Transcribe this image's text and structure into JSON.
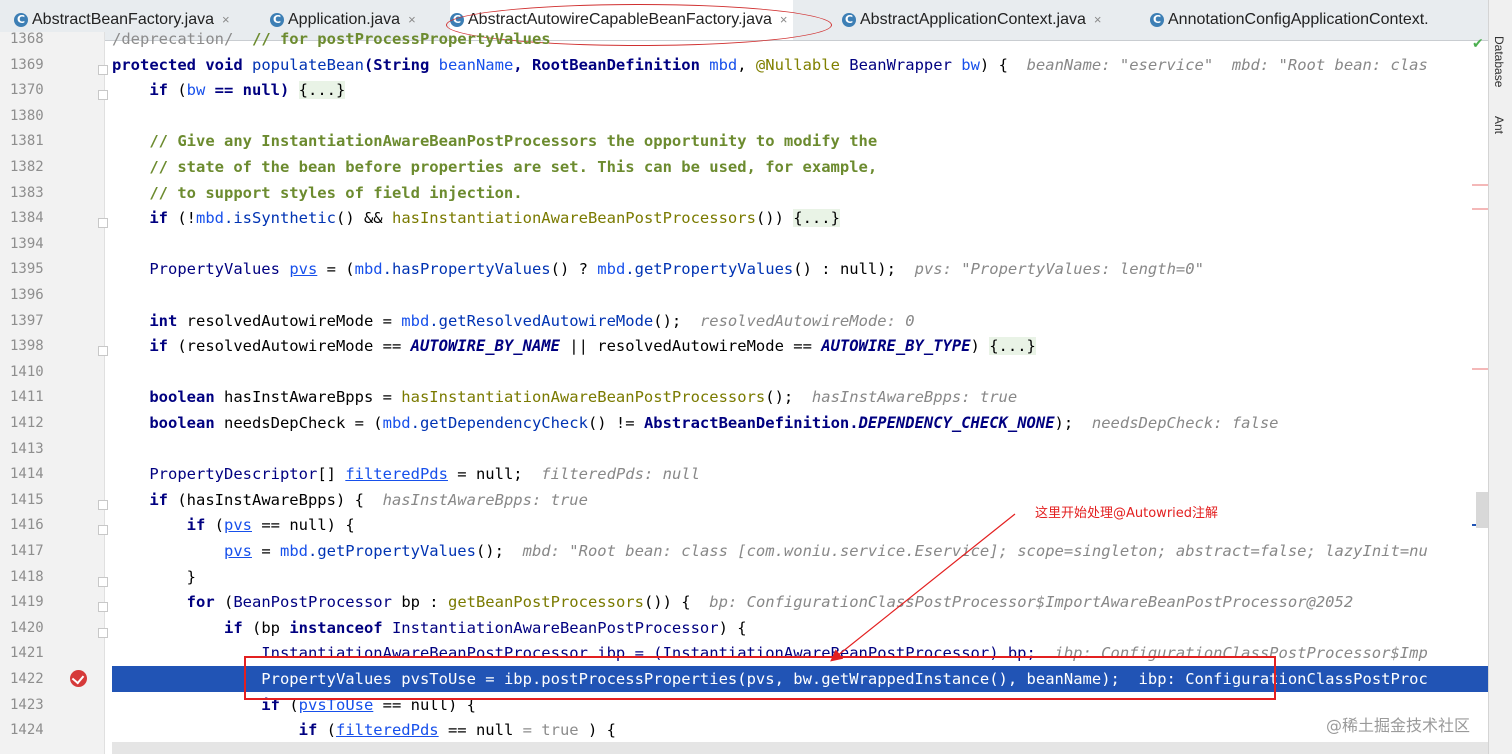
{
  "tabs": [
    {
      "label": "AbstractBeanFactory.java",
      "close": "×"
    },
    {
      "label": "Application.java",
      "close": "×"
    },
    {
      "label": "AbstractAutowireCapableBeanFactory.java",
      "close": "×"
    },
    {
      "label": "AbstractApplicationContext.java",
      "close": "×"
    },
    {
      "label": "AnnotationConfigApplicationContext.",
      "close": ""
    }
  ],
  "tab_icon_letter": "C",
  "side_tools": [
    "Database",
    "Ant"
  ],
  "annotation_text": "这里开始处理@Autowried注解",
  "watermark": "@稀土掘金技术社区",
  "editor": {
    "breakpoint_line": "1422",
    "lines": [
      {
        "n": "1368",
        "segments": [
          {
            "t": "/deprecation/  ",
            "c": "cs"
          },
          {
            "t": "// for postProcessPropertyValues",
            "c": "c"
          }
        ]
      },
      {
        "n": "1369",
        "segments": [
          {
            "t": "protected void ",
            "c": "k"
          },
          {
            "t": "populateBean",
            "c": "m"
          },
          {
            "t": "(String ",
            "c": "k"
          },
          {
            "t": "beanName",
            "c": "v"
          },
          {
            "t": ", RootBeanDefinition ",
            "c": "k"
          },
          {
            "t": "mbd",
            "c": "v"
          },
          {
            "t": ", ",
            "c": ""
          },
          {
            "t": "@Nullable ",
            "c": "an"
          },
          {
            "t": "BeanWrapper ",
            "c": "t"
          },
          {
            "t": "bw",
            "c": "v"
          },
          {
            "t": ") {  ",
            "c": ""
          },
          {
            "t": "beanName: \"eservice\"  mbd: \"Root bean: clas",
            "c": "h"
          }
        ]
      },
      {
        "n": "1370",
        "segments": [
          {
            "t": "    if ",
            "c": "k"
          },
          {
            "t": "(",
            "c": ""
          },
          {
            "t": "bw",
            "c": "v"
          },
          {
            "t": " == null) ",
            "c": "k"
          },
          {
            "t": "{...}",
            "c": "fb"
          }
        ]
      },
      {
        "n": "1380",
        "segments": []
      },
      {
        "n": "1381",
        "segments": [
          {
            "t": "    // Give any InstantiationAwareBeanPostProcessors the opportunity to modify the",
            "c": "c"
          }
        ]
      },
      {
        "n": "1382",
        "segments": [
          {
            "t": "    // state of the bean before properties are set. This can be used, for example,",
            "c": "c"
          }
        ]
      },
      {
        "n": "1383",
        "segments": [
          {
            "t": "    // to support styles of field injection.",
            "c": "c"
          }
        ]
      },
      {
        "n": "1384",
        "segments": [
          {
            "t": "    if ",
            "c": "k"
          },
          {
            "t": "(!",
            "c": ""
          },
          {
            "t": "mbd",
            "c": "v"
          },
          {
            "t": ".isSynthetic",
            "c": "m"
          },
          {
            "t": "() && ",
            "c": ""
          },
          {
            "t": "hasInstantiationAwareBeanPostProcessors",
            "c": "f"
          },
          {
            "t": "()) ",
            "c": ""
          },
          {
            "t": "{...}",
            "c": "fb"
          }
        ]
      },
      {
        "n": "1394",
        "segments": []
      },
      {
        "n": "1395",
        "segments": [
          {
            "t": "    PropertyValues ",
            "c": "t"
          },
          {
            "t": "pvs",
            "c": "u"
          },
          {
            "t": " = (",
            "c": ""
          },
          {
            "t": "mbd",
            "c": "v"
          },
          {
            "t": ".hasPropertyValues",
            "c": "m"
          },
          {
            "t": "() ? ",
            "c": ""
          },
          {
            "t": "mbd",
            "c": "v"
          },
          {
            "t": ".getPropertyValues",
            "c": "m"
          },
          {
            "t": "() : null);  ",
            "c": ""
          },
          {
            "t": "pvs: \"PropertyValues: length=0\"",
            "c": "h"
          }
        ]
      },
      {
        "n": "1396",
        "segments": []
      },
      {
        "n": "1397",
        "segments": [
          {
            "t": "    int ",
            "c": "k"
          },
          {
            "t": "resolvedAutowireMode = ",
            "c": ""
          },
          {
            "t": "mbd",
            "c": "v"
          },
          {
            "t": ".getResolvedAutowireMode",
            "c": "m"
          },
          {
            "t": "();  ",
            "c": ""
          },
          {
            "t": "resolvedAutowireMode: 0",
            "c": "h"
          }
        ]
      },
      {
        "n": "1398",
        "segments": [
          {
            "t": "    if ",
            "c": "k"
          },
          {
            "t": "(resolvedAutowireMode == ",
            "c": ""
          },
          {
            "t": "AUTOWIRE_BY_NAME",
            "c": "it"
          },
          {
            "t": " || resolvedAutowireMode == ",
            "c": ""
          },
          {
            "t": "AUTOWIRE_BY_TYPE",
            "c": "it"
          },
          {
            "t": ") ",
            "c": ""
          },
          {
            "t": "{...}",
            "c": "fb"
          }
        ]
      },
      {
        "n": "1410",
        "segments": []
      },
      {
        "n": "1411",
        "segments": [
          {
            "t": "    boolean ",
            "c": "k"
          },
          {
            "t": "hasInstAwareBpps = ",
            "c": ""
          },
          {
            "t": "hasInstantiationAwareBeanPostProcessors",
            "c": "f"
          },
          {
            "t": "();  ",
            "c": ""
          },
          {
            "t": "hasInstAwareBpps: true",
            "c": "h"
          }
        ]
      },
      {
        "n": "1412",
        "segments": [
          {
            "t": "    boolean ",
            "c": "k"
          },
          {
            "t": "needsDepCheck = (",
            "c": ""
          },
          {
            "t": "mbd",
            "c": "v"
          },
          {
            "t": ".getDependencyCheck",
            "c": "m"
          },
          {
            "t": "() != ",
            "c": ""
          },
          {
            "t": "AbstractBeanDefinition.",
            "c": "k"
          },
          {
            "t": "DEPENDENCY_CHECK_NONE",
            "c": "it"
          },
          {
            "t": ");  ",
            "c": ""
          },
          {
            "t": "needsDepCheck: false",
            "c": "h"
          }
        ]
      },
      {
        "n": "1413",
        "segments": []
      },
      {
        "n": "1414",
        "segments": [
          {
            "t": "    PropertyDescriptor",
            "c": "t"
          },
          {
            "t": "[] ",
            "c": ""
          },
          {
            "t": "filteredPds",
            "c": "u"
          },
          {
            "t": " = null;  ",
            "c": ""
          },
          {
            "t": "filteredPds: null",
            "c": "h"
          }
        ]
      },
      {
        "n": "1415",
        "segments": [
          {
            "t": "    if ",
            "c": "k"
          },
          {
            "t": "(hasInstAwareBpps) {  ",
            "c": ""
          },
          {
            "t": "hasInstAwareBpps: true",
            "c": "h"
          }
        ]
      },
      {
        "n": "1416",
        "segments": [
          {
            "t": "        if ",
            "c": "k"
          },
          {
            "t": "(",
            "c": ""
          },
          {
            "t": "pvs",
            "c": "u"
          },
          {
            "t": " == null) {",
            "c": ""
          }
        ]
      },
      {
        "n": "1417",
        "segments": [
          {
            "t": "            ",
            "c": ""
          },
          {
            "t": "pvs",
            "c": "u"
          },
          {
            "t": " = ",
            "c": ""
          },
          {
            "t": "mbd",
            "c": "v"
          },
          {
            "t": ".getPropertyValues",
            "c": "m"
          },
          {
            "t": "();  ",
            "c": ""
          },
          {
            "t": "mbd: \"Root bean: class [com.woniu.service.Eservice]; scope=singleton; abstract=false; lazyInit=nu",
            "c": "h"
          }
        ]
      },
      {
        "n": "1418",
        "segments": [
          {
            "t": "        }",
            "c": ""
          }
        ]
      },
      {
        "n": "1419",
        "segments": [
          {
            "t": "        for ",
            "c": "k"
          },
          {
            "t": "(",
            "c": ""
          },
          {
            "t": "BeanPostProcessor ",
            "c": "t"
          },
          {
            "t": "bp : ",
            "c": ""
          },
          {
            "t": "getBeanPostProcessors",
            "c": "f"
          },
          {
            "t": "()) {  ",
            "c": ""
          },
          {
            "t": "bp: ConfigurationClassPostProcessor$ImportAwareBeanPostProcessor@2052",
            "c": "h"
          }
        ]
      },
      {
        "n": "1420",
        "segments": [
          {
            "t": "            if ",
            "c": "k"
          },
          {
            "t": "(bp ",
            "c": ""
          },
          {
            "t": "instanceof ",
            "c": "k"
          },
          {
            "t": "InstantiationAwareBeanPostProcessor",
            "c": "t"
          },
          {
            "t": ") {",
            "c": ""
          }
        ]
      },
      {
        "n": "1421",
        "segments": [
          {
            "t": "                InstantiationAwareBeanPostProcessor ibp = (InstantiationAwareBeanPostProcessor) bp;  ",
            "c": "t"
          },
          {
            "t": "ibp: ConfigurationClassPostProcessor$Imp",
            "c": "h"
          }
        ]
      },
      {
        "n": "1422",
        "segments": [
          {
            "t": "                PropertyValues ",
            "c": ""
          },
          {
            "t": "pvsToUse",
            "c": ""
          },
          {
            "t": " = ibp.postProcessProperties(",
            "c": ""
          },
          {
            "t": "pvs",
            "c": ""
          },
          {
            "t": ", bw.getWrappedInstance(), beanName);  ",
            "c": ""
          },
          {
            "t": "ibp: ConfigurationClassPostProc",
            "c": ""
          }
        ]
      },
      {
        "n": "1423",
        "segments": [
          {
            "t": "                if ",
            "c": "k"
          },
          {
            "t": "(",
            "c": ""
          },
          {
            "t": "pvsToUse",
            "c": "u"
          },
          {
            "t": " == null) {",
            "c": ""
          }
        ]
      },
      {
        "n": "1424",
        "segments": [
          {
            "t": "                    if ",
            "c": "k"
          },
          {
            "t": "(",
            "c": ""
          },
          {
            "t": "filteredPds",
            "c": "u"
          },
          {
            "t": " == null ",
            "c": ""
          },
          {
            "t": "= true ",
            "c": "cs"
          },
          {
            "t": ") {",
            "c": ""
          }
        ]
      }
    ]
  }
}
